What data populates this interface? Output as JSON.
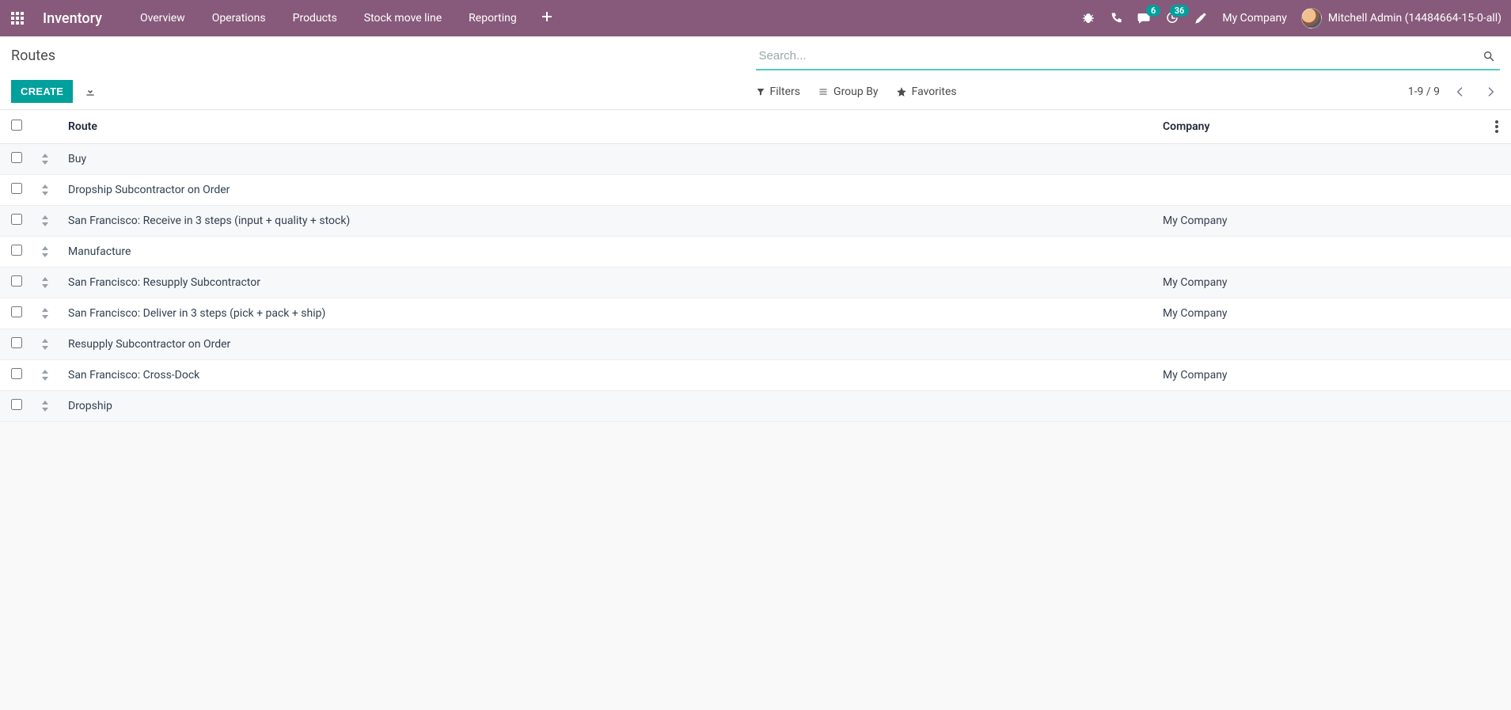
{
  "navbar": {
    "app_title": "Inventory",
    "menu": [
      "Overview",
      "Operations",
      "Products",
      "Stock move line",
      "Reporting"
    ],
    "messages_badge": "6",
    "activities_badge": "36",
    "company": "My Company",
    "user": "Mitchell Admin (14484664-15-0-all)"
  },
  "control": {
    "breadcrumb": "Routes",
    "search_placeholder": "Search...",
    "create_label": "CREATE",
    "filters_label": "Filters",
    "groupby_label": "Group By",
    "favorites_label": "Favorites",
    "pager": "1-9 / 9"
  },
  "table": {
    "col_route": "Route",
    "col_company": "Company",
    "rows": [
      {
        "route": "Buy",
        "company": ""
      },
      {
        "route": "Dropship Subcontractor on Order",
        "company": ""
      },
      {
        "route": "San Francisco: Receive in 3 steps (input + quality + stock)",
        "company": "My Company"
      },
      {
        "route": "Manufacture",
        "company": ""
      },
      {
        "route": "San Francisco: Resupply Subcontractor",
        "company": "My Company"
      },
      {
        "route": "San Francisco: Deliver in 3 steps (pick + pack + ship)",
        "company": "My Company"
      },
      {
        "route": "Resupply Subcontractor on Order",
        "company": ""
      },
      {
        "route": "San Francisco: Cross-Dock",
        "company": "My Company"
      },
      {
        "route": "Dropship",
        "company": ""
      }
    ]
  }
}
